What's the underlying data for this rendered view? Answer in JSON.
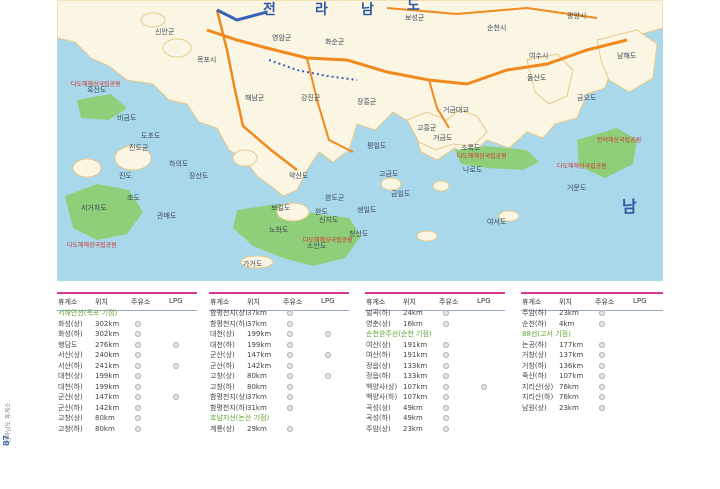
{
  "map": {
    "place_labels": [
      "신안군",
      "영암군",
      "화순군",
      "보성군",
      "순천시",
      "여수시",
      "광양시",
      "목포시",
      "해남군",
      "강진군",
      "장흥군",
      "고흥군",
      "진도군",
      "완도군",
      "진도",
      "완도",
      "소안도",
      "노화도",
      "청산도",
      "금일도",
      "거금도",
      "소록도",
      "나로도",
      "돌산도",
      "남해도",
      "거문도",
      "고금도",
      "생일도",
      "가거도",
      "비금도",
      "도초도",
      "하의도",
      "장산도",
      "흑산도",
      "평일도",
      "약산도",
      "신지도",
      "보길도",
      "조도",
      "관매도",
      "서거차도",
      "여서도",
      "거금대교",
      "금오도"
    ],
    "park_labels": [
      "다도해해상국립공원",
      "다도해해상국립공원",
      "다도해해상국립공원",
      "한려해상국립공원",
      "다도해해상국립공원",
      "다도해해상국립공원"
    ],
    "sea_label": "남",
    "province_letters": [
      "전",
      "라",
      "남",
      "도"
    ],
    "colors": {
      "sea": "#a9d8ea",
      "land": "#fbf6e3",
      "park": "#8fcf7a",
      "highway": "#f08a1f",
      "expressway_accent": "#3a62b8",
      "table_rule": "#d9348e"
    }
  },
  "table": {
    "headers": [
      "휴게소",
      "위치",
      "주유소",
      "LPG"
    ],
    "columns": [
      [
        {
          "type": "section",
          "text": "서해안선(목포 기점)"
        },
        {
          "name": "화성(상)",
          "pos": "302km",
          "fuel": true,
          "lpg": false
        },
        {
          "name": "화성(하)",
          "pos": "302km",
          "fuel": true,
          "lpg": false
        },
        {
          "name": "행담도",
          "pos": "276km",
          "fuel": true,
          "lpg": true
        },
        {
          "name": "서산(상)",
          "pos": "240km",
          "fuel": true,
          "lpg": false
        },
        {
          "name": "서산(하)",
          "pos": "241km",
          "fuel": true,
          "lpg": true
        },
        {
          "name": "대천(상)",
          "pos": "199km",
          "fuel": true,
          "lpg": false
        },
        {
          "name": "대천(하)",
          "pos": "199km",
          "fuel": true,
          "lpg": false
        },
        {
          "name": "군산(상)",
          "pos": "147km",
          "fuel": true,
          "lpg": true
        },
        {
          "name": "군산(하)",
          "pos": "142km",
          "fuel": true,
          "lpg": false
        },
        {
          "name": "고창(상)",
          "pos": "80km",
          "fuel": true,
          "lpg": false
        },
        {
          "name": "고창(하)",
          "pos": "80km",
          "fuel": true,
          "lpg": false
        }
      ],
      [
        {
          "name": "함평천지(상)",
          "pos": "37km",
          "fuel": true,
          "lpg": false
        },
        {
          "name": "함평천지(하)",
          "pos": "37km",
          "fuel": true,
          "lpg": false
        },
        {
          "name": "대천(상)",
          "pos": "199km",
          "fuel": true,
          "lpg": true
        },
        {
          "name": "대천(하)",
          "pos": "199km",
          "fuel": true,
          "lpg": false
        },
        {
          "name": "군산(상)",
          "pos": "147km",
          "fuel": true,
          "lpg": true
        },
        {
          "name": "군산(하)",
          "pos": "142km",
          "fuel": true,
          "lpg": false
        },
        {
          "name": "고창(상)",
          "pos": "80km",
          "fuel": true,
          "lpg": true
        },
        {
          "name": "고창(하)",
          "pos": "80km",
          "fuel": true,
          "lpg": false
        },
        {
          "name": "함평천지(상)",
          "pos": "37km",
          "fuel": true,
          "lpg": false
        },
        {
          "name": "함평천지(하)",
          "pos": "31km",
          "fuel": true,
          "lpg": false
        },
        {
          "type": "section",
          "text": "호남지선(논산 기점)"
        },
        {
          "name": "계룡(상)",
          "pos": "29km",
          "fuel": true,
          "lpg": false
        }
      ],
      [
        {
          "name": "벌곡(하)",
          "pos": "24km",
          "fuel": true,
          "lpg": false
        },
        {
          "name": "영춘(상)",
          "pos": "16km",
          "fuel": true,
          "lpg": false
        },
        {
          "type": "section",
          "text": "순천완주선(순천 기점)"
        },
        {
          "name": "여산(상)",
          "pos": "191km",
          "fuel": true,
          "lpg": false
        },
        {
          "name": "여산(하)",
          "pos": "191km",
          "fuel": true,
          "lpg": false
        },
        {
          "name": "정읍(상)",
          "pos": "133km",
          "fuel": true,
          "lpg": false
        },
        {
          "name": "정읍(하)",
          "pos": "133km",
          "fuel": true,
          "lpg": false
        },
        {
          "name": "백양사(상)",
          "pos": "107km",
          "fuel": true,
          "lpg": true
        },
        {
          "name": "백양사(하)",
          "pos": "107km",
          "fuel": true,
          "lpg": false
        },
        {
          "name": "곡성(상)",
          "pos": "49km",
          "fuel": true,
          "lpg": false
        },
        {
          "name": "곡성(하)",
          "pos": "49km",
          "fuel": true,
          "lpg": false
        },
        {
          "name": "주암(상)",
          "pos": "23km",
          "fuel": true,
          "lpg": false
        }
      ],
      [
        {
          "name": "주암(하)",
          "pos": "23km",
          "fuel": true,
          "lpg": false
        },
        {
          "name": "순천(하)",
          "pos": "4km",
          "fuel": true,
          "lpg": false
        },
        {
          "type": "section",
          "text": "88선(고서 기점)"
        },
        {
          "name": "논공(하)",
          "pos": "177km",
          "fuel": true,
          "lpg": false
        },
        {
          "name": "거창(상)",
          "pos": "137km",
          "fuel": true,
          "lpg": false
        },
        {
          "name": "거창(하)",
          "pos": "136km",
          "fuel": true,
          "lpg": false
        },
        {
          "name": "죽산(하)",
          "pos": "107km",
          "fuel": true,
          "lpg": false
        },
        {
          "name": "지리산(상)",
          "pos": "76km",
          "fuel": true,
          "lpg": false
        },
        {
          "name": "지리산(하)",
          "pos": "76km",
          "fuel": true,
          "lpg": false
        },
        {
          "name": "남원(상)",
          "pos": "23km",
          "fuel": true,
          "lpg": false
        }
      ]
    ]
  },
  "sidebar": {
    "caption": "전라남도 휴게소",
    "page_number": "87"
  }
}
